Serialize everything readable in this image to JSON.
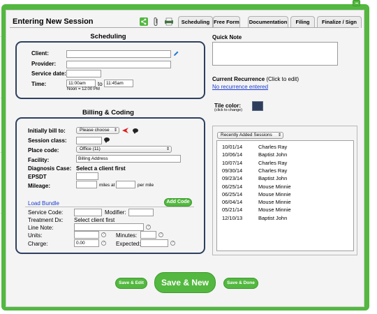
{
  "dialog": {
    "title": "Entering New Session"
  },
  "tabs": [
    "Scheduling",
    "Free Form",
    "Documentation",
    "Filing",
    "Finalize / Sign"
  ],
  "scheduling": {
    "heading": "Scheduling",
    "client_label": "Client:",
    "provider_label": "Provider:",
    "service_date_label": "Service date:",
    "time_label": "Time:",
    "time_start": "11:00am",
    "time_to": "to",
    "time_end": "11:45am",
    "noon_note": "Noon = 12:00 PM"
  },
  "billing": {
    "heading": "Billing & Coding",
    "initially_bill_label": "Initially bill to:",
    "initially_bill_value": "Please choose",
    "session_class_label": "Session class:",
    "place_code_label": "Place code:",
    "place_code_value": "Office (11)",
    "facility_label": "Facility:",
    "facility_value": "Billing Address",
    "diagnosis_label": "Diagnosis Case:",
    "diagnosis_value": "Select a client first",
    "epsdt_label": "EPSDT",
    "mileage_label": "Mileage:",
    "miles_at": "miles at",
    "per_mile": "per mile"
  },
  "codes": {
    "load_bundle": "Load Bundle",
    "add_code": "Add Code",
    "service_code_label": "Service Code:",
    "modifier_label": "Modifier:",
    "treatment_dx_label": "Treatment Dx:",
    "treatment_dx_value": "Select client first",
    "line_note_label": "Line Note:",
    "units_label": "Units:",
    "minutes_label": "Minutes:",
    "charge_label": "Charge:",
    "charge_value": "0.00",
    "expected_label": "Expected:"
  },
  "right": {
    "quick_note_label": "Quick Note",
    "recurrence_label": "Current Recurrence",
    "recurrence_hint": "(Click to edit)",
    "recurrence_link": "No recurrence entered",
    "tile_color_label": "Tile color:",
    "tile_color_hint": "(click to change)",
    "tile_color": "#2f3d5c"
  },
  "sessions": {
    "dropdown": "Recently Added Sessions",
    "rows": [
      {
        "date": "10/01/14",
        "name": "Charles Ray"
      },
      {
        "date": "10/06/14",
        "name": "Baptist John"
      },
      {
        "date": "10/07/14",
        "name": "Charles Ray"
      },
      {
        "date": "09/30/14",
        "name": "Charles Ray"
      },
      {
        "date": "09/23/14",
        "name": "Baptist John"
      },
      {
        "date": "06/25/14",
        "name": "Mouse Minnie"
      },
      {
        "date": "06/25/14",
        "name": "Mouse Minnie"
      },
      {
        "date": "06/04/14",
        "name": "Mouse Minnie"
      },
      {
        "date": "05/21/14",
        "name": "Mouse Minnie"
      },
      {
        "date": "12/10/13",
        "name": "Baptist John"
      }
    ]
  },
  "footer": {
    "save_edit": "Save & Edit",
    "save_new": "Save & New",
    "save_done": "Save & Done"
  },
  "colors": {
    "accent": "#53b840",
    "box_border": "#2d4060",
    "link": "#1a3ccf",
    "arrow": "#e01818"
  },
  "icons": [
    "close-icon",
    "share-icon",
    "paperclip-icon",
    "print-icon",
    "edit-pencil-icon",
    "red-arrow-icon",
    "chat-bubble-icon",
    "help-icon"
  ]
}
